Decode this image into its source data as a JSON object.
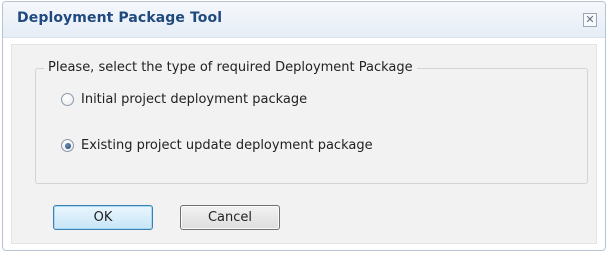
{
  "window": {
    "title": "Deployment Package Tool",
    "close_glyph": "✕"
  },
  "group": {
    "legend": "Please, select the type of required Deployment Package",
    "options": [
      {
        "label": "Initial project deployment package",
        "checked": false
      },
      {
        "label": "Existing project update deployment package",
        "checked": true
      }
    ]
  },
  "buttons": {
    "ok_label": "OK",
    "cancel_label": "Cancel"
  },
  "colors": {
    "title_text": "#1f4a7e",
    "ok_border": "#3c7fb1"
  }
}
